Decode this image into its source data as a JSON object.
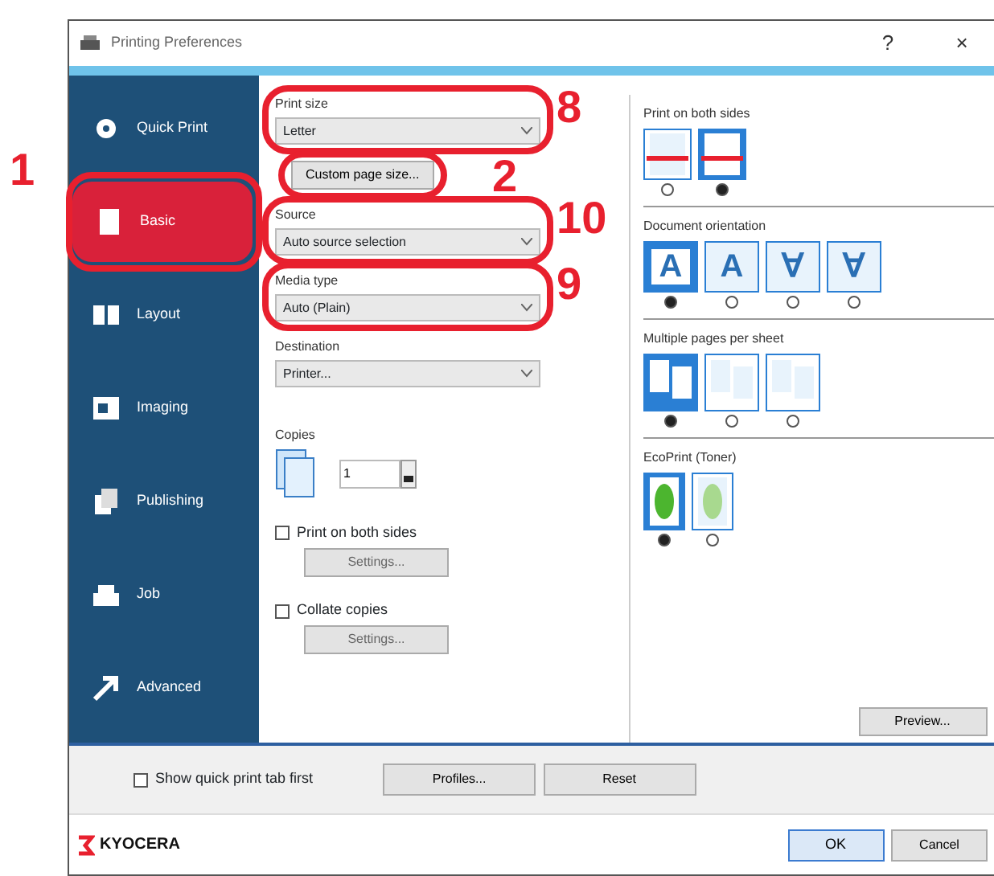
{
  "window": {
    "title": "Printing Preferences",
    "help": "?",
    "close": "×"
  },
  "sidebar": {
    "callout": "1",
    "items": [
      {
        "label": "Quick Print",
        "selected": false
      },
      {
        "label": "Basic",
        "selected": true
      },
      {
        "label": "Layout",
        "selected": false
      },
      {
        "label": "Imaging",
        "selected": false
      },
      {
        "label": "Publishing",
        "selected": false
      },
      {
        "label": "Job",
        "selected": false
      },
      {
        "label": "Advanced",
        "selected": false
      }
    ]
  },
  "basic": [
    {
      "kind": "select",
      "label": "Print size",
      "value": "Letter",
      "callout": "8"
    },
    {
      "kind": "button",
      "label": "Custom page size...",
      "callout": "2"
    },
    {
      "kind": "select",
      "label": "Source",
      "value": "Auto source selection",
      "callout": "10"
    },
    {
      "kind": "select",
      "label": "Media type",
      "value": "Auto (Plain)",
      "callout": "9"
    },
    {
      "kind": "select",
      "label": "Destination",
      "value": "Printer..."
    }
  ],
  "copies": {
    "label": "Copies",
    "value": "1"
  },
  "options": [
    {
      "label": "Print on both sides",
      "checked": false,
      "button": "Settings..."
    },
    {
      "label": "Collate copies",
      "checked": false,
      "button": "Settings..."
    }
  ],
  "panels": [
    {
      "label": "Print on both sides",
      "options": [
        {
          "selected": false
        },
        {
          "selected": true
        }
      ]
    },
    {
      "label": "Document orientation",
      "options": [
        {
          "glyph": "A",
          "selected": true
        },
        {
          "glyph": "A",
          "selected": false
        },
        {
          "glyph": "∀",
          "selected": false
        },
        {
          "glyph": "∀",
          "selected": false
        }
      ]
    },
    {
      "label": "Multiple pages per sheet",
      "options": [
        {
          "selected": true
        },
        {
          "selected": false
        },
        {
          "selected": false
        }
      ]
    },
    {
      "label": "EcoPrint (Toner)",
      "options": [
        {
          "selected": true
        },
        {
          "selected": false
        }
      ]
    }
  ],
  "panel_button": "Preview...",
  "bottom": {
    "checkbox": {
      "label": "Show quick print tab first",
      "checked": false
    },
    "buttons": [
      "Profiles...",
      "Reset"
    ]
  },
  "footer": {
    "logo": "KYOCERA",
    "buttons": [
      "OK",
      "Cancel"
    ]
  }
}
